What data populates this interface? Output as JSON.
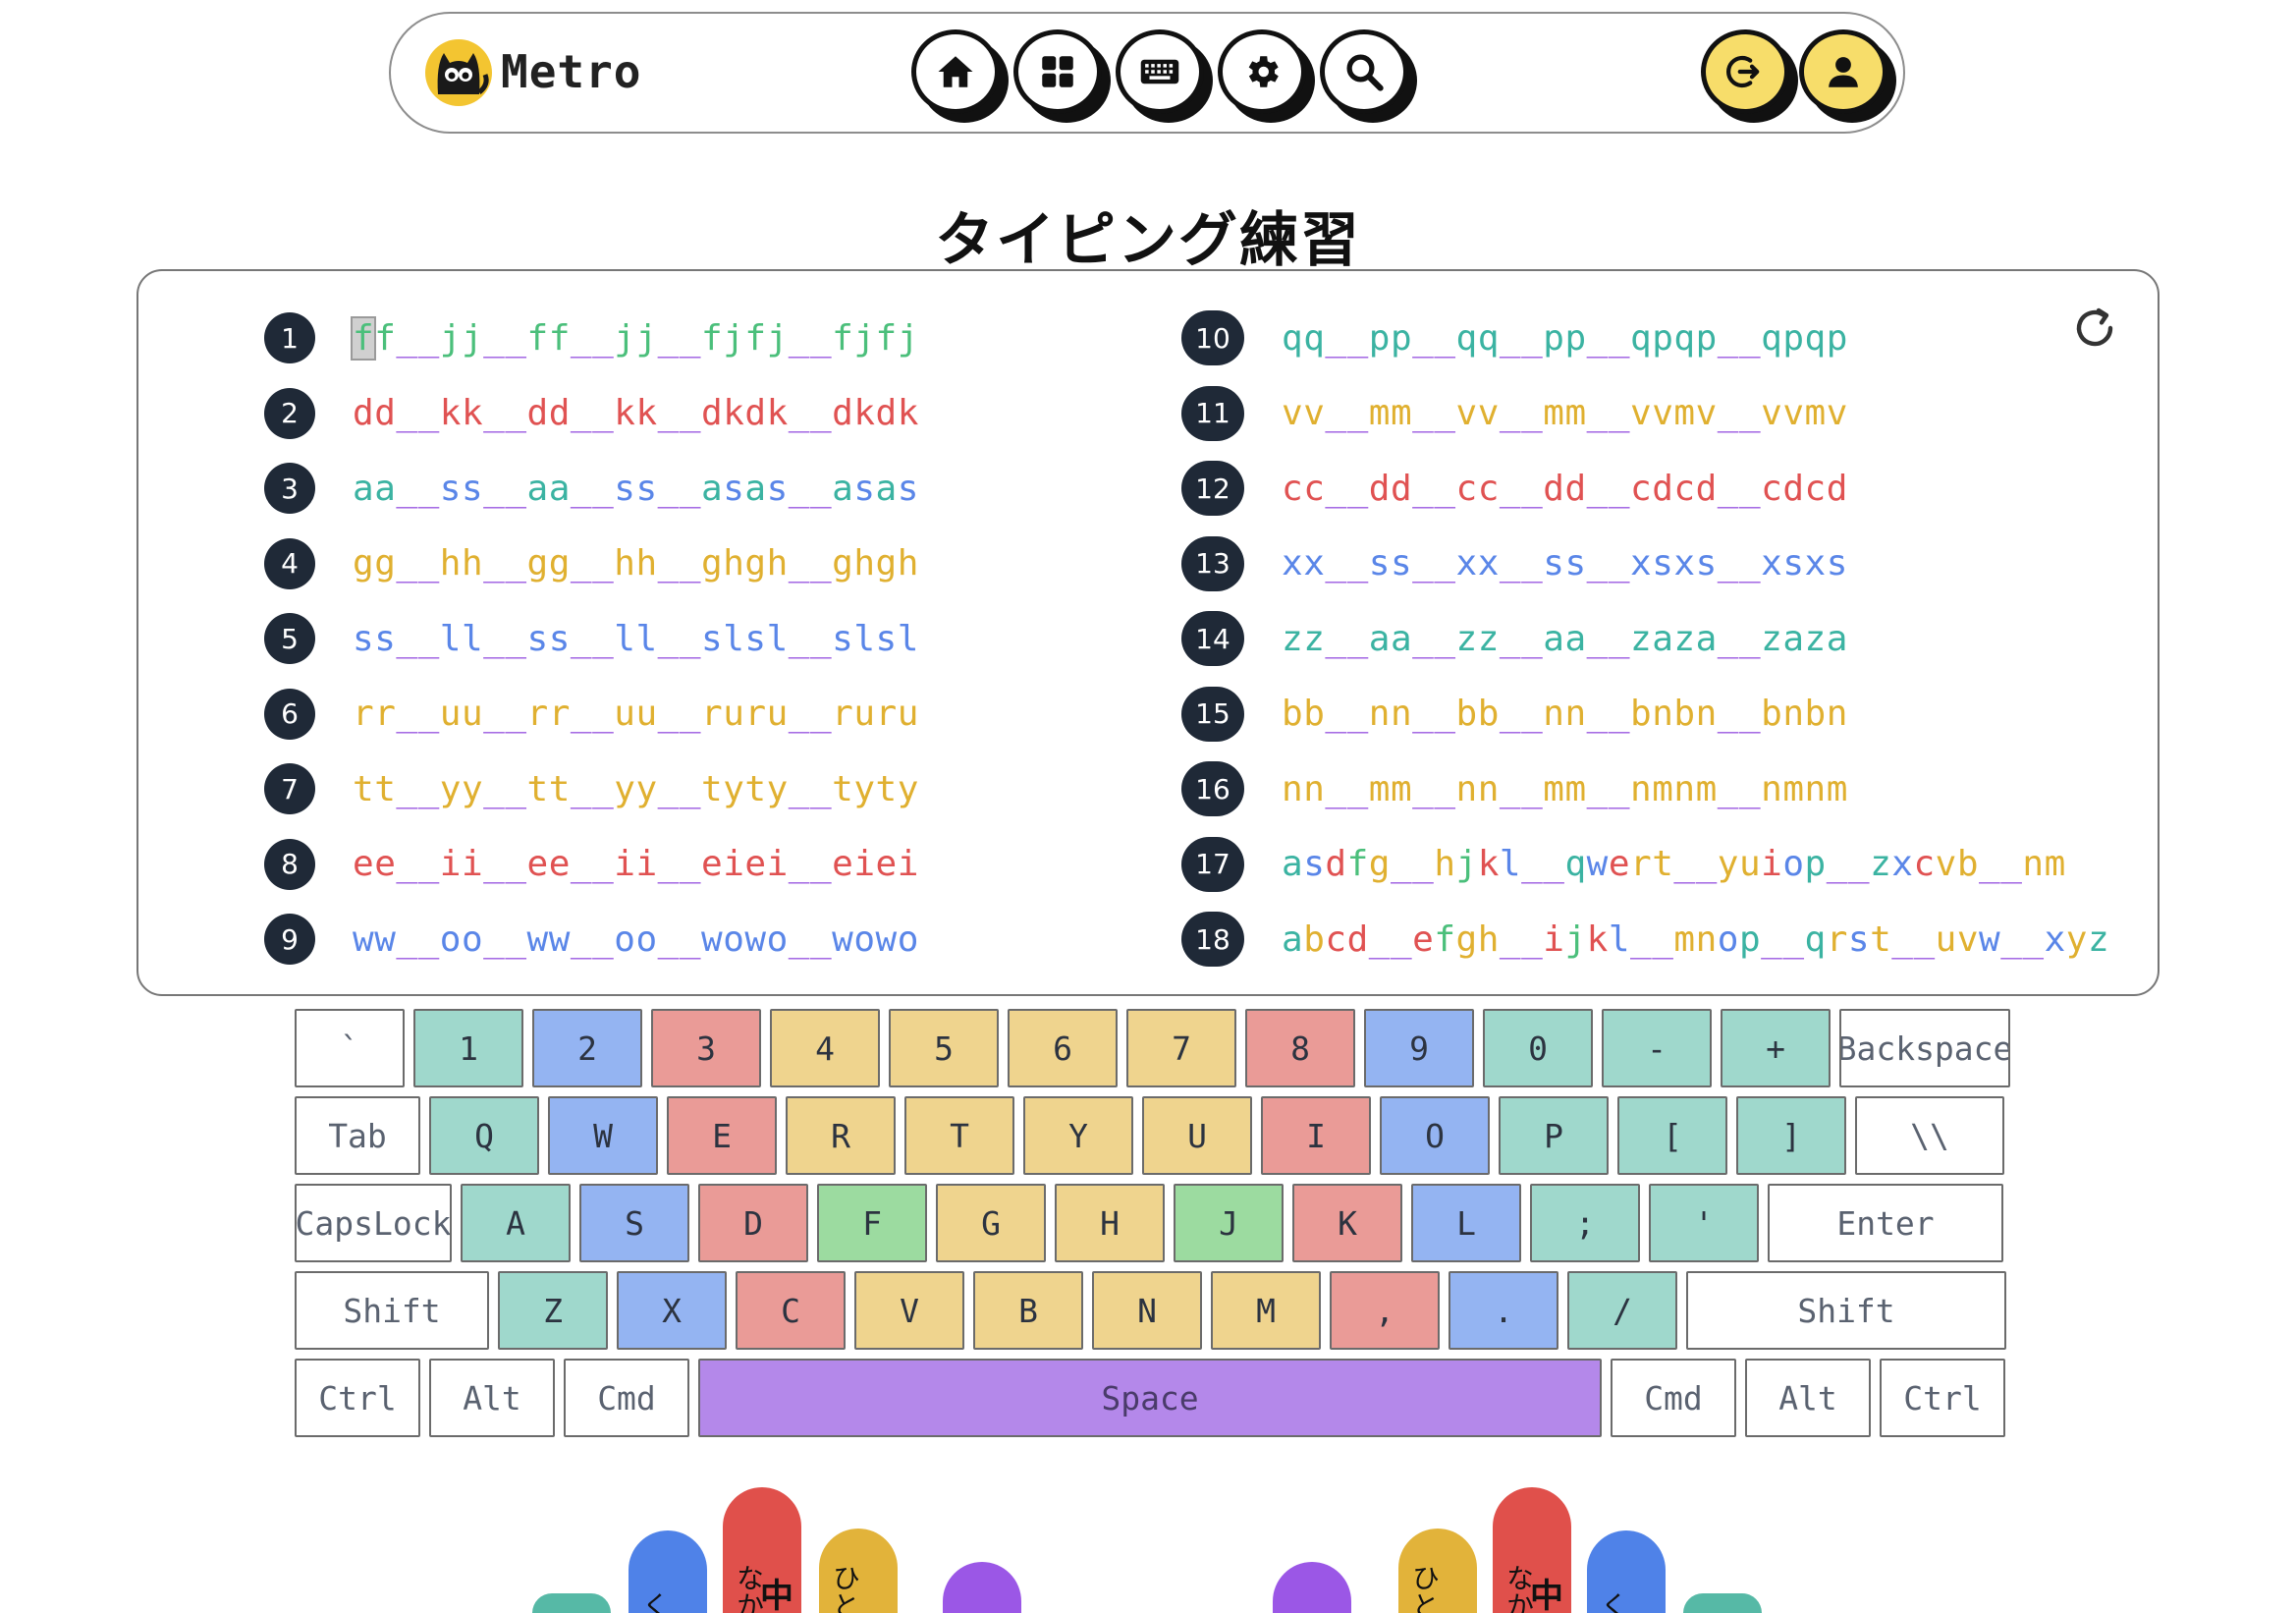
{
  "header": {
    "brand": "Metro",
    "nav": [
      "home-icon",
      "grid-icon",
      "keyboard-icon",
      "gear-icon",
      "search-icon"
    ],
    "actions": [
      "logout-icon",
      "user-icon"
    ]
  },
  "page_title": "タイピング練習",
  "exercises_left": [
    {
      "num": "1",
      "color": "#4bbf7b",
      "text": "ff__jj__ff__jj__fjfj__fjfj"
    },
    {
      "num": "2",
      "color": "#e05252",
      "text": "dd__kk__dd__kk__dkdk__dkdk"
    },
    {
      "num": "3",
      "color": "#3bb3a2",
      "alt": "#5a86e8",
      "text": "aa__ss__aa__ss__asas__asas"
    },
    {
      "num": "4",
      "color": "#e0b030",
      "text": "gg__hh__gg__hh__ghgh__ghgh"
    },
    {
      "num": "5",
      "color": "#5a86e8",
      "text": "ss__ll__ss__ll__slsl__slsl"
    },
    {
      "num": "6",
      "color": "#e0b030",
      "text": "rr__uu__rr__uu__ruru__ruru"
    },
    {
      "num": "7",
      "color": "#e0b030",
      "text": "tt__yy__tt__yy__tyty__tyty"
    },
    {
      "num": "8",
      "color": "#e05252",
      "text": "ee__ii__ee__ii__eiei__eiei"
    },
    {
      "num": "9",
      "color": "#5a86e8",
      "text": "ww__oo__ww__oo__wowo__wowo"
    }
  ],
  "exercises_right": [
    {
      "num": "10",
      "color": "#3bb3a2",
      "text": "qq__pp__qq__pp__qpqp__qpqp"
    },
    {
      "num": "11",
      "color": "#e0b030",
      "text": "vv__mm__vv__mm__vvmv__vvmv"
    },
    {
      "num": "12",
      "color": "#e05252",
      "text": "cc__dd__cc__dd__cdcd__cdcd"
    },
    {
      "num": "13",
      "color": "#5a86e8",
      "text": "xx__ss__xx__ss__xsxs__xsxs"
    },
    {
      "num": "14",
      "color": "#3bb3a2",
      "text": "zz__aa__zz__aa__zaza__zaza"
    },
    {
      "num": "15",
      "color": "#e0b030",
      "text": "bb__nn__bb__nn__bnbn__bnbn"
    },
    {
      "num": "16",
      "color": "#e0b030",
      "text": "nn__mm__nn__mm__nmnm__nmnm"
    },
    {
      "num": "17",
      "color": "#3bb3a2",
      "text": "asdfg__hjkl__qwert__yuiop__zxcvb__nm"
    },
    {
      "num": "18",
      "color": "#3bb3a2",
      "text": "abcd__efgh__ijkl__mnop__qrst__uvw__xyz"
    }
  ],
  "char_colors": {
    "a": "#3bb3a2",
    "q": "#3bb3a2",
    "z": "#3bb3a2",
    "p": "#3bb3a2",
    "s": "#5a86e8",
    "w": "#5a86e8",
    "x": "#5a86e8",
    "l": "#5a86e8",
    "o": "#5a86e8",
    "d": "#e05252",
    "e": "#e05252",
    "c": "#e05252",
    "k": "#e05252",
    "i": "#e05252",
    "f": "#4bbf7b",
    "j": "#4bbf7b",
    "g": "#e0b030",
    "h": "#e0b030",
    "r": "#e0b030",
    "t": "#e0b030",
    "y": "#e0b030",
    "u": "#e0b030",
    "v": "#e0b030",
    "b": "#e0b030",
    "n": "#e0b030",
    "m": "#e0b030",
    "_": "#9b59e0"
  },
  "keyboard": {
    "row1": [
      {
        "label": "`",
        "c": "white"
      },
      {
        "label": "1",
        "c": "teal"
      },
      {
        "label": "2",
        "c": "blue"
      },
      {
        "label": "3",
        "c": "red"
      },
      {
        "label": "4",
        "c": "yellow"
      },
      {
        "label": "5",
        "c": "yellow"
      },
      {
        "label": "6",
        "c": "yellow"
      },
      {
        "label": "7",
        "c": "yellow"
      },
      {
        "label": "8",
        "c": "red"
      },
      {
        "label": "9",
        "c": "blue"
      },
      {
        "label": "0",
        "c": "teal"
      },
      {
        "label": "-",
        "c": "teal"
      },
      {
        "label": "+",
        "c": "teal"
      },
      {
        "label": "Backspace",
        "c": "white"
      }
    ],
    "row2": [
      {
        "label": "Tab",
        "c": "white"
      },
      {
        "label": "Q",
        "c": "teal"
      },
      {
        "label": "W",
        "c": "blue"
      },
      {
        "label": "E",
        "c": "red"
      },
      {
        "label": "R",
        "c": "yellow"
      },
      {
        "label": "T",
        "c": "yellow"
      },
      {
        "label": "Y",
        "c": "yellow"
      },
      {
        "label": "U",
        "c": "yellow"
      },
      {
        "label": "I",
        "c": "red"
      },
      {
        "label": "O",
        "c": "blue"
      },
      {
        "label": "P",
        "c": "teal"
      },
      {
        "label": "[",
        "c": "teal"
      },
      {
        "label": "]",
        "c": "teal"
      },
      {
        "label": "\\\\",
        "c": "white"
      }
    ],
    "row3": [
      {
        "label": "CapsLock",
        "c": "white"
      },
      {
        "label": "A",
        "c": "teal"
      },
      {
        "label": "S",
        "c": "blue"
      },
      {
        "label": "D",
        "c": "red"
      },
      {
        "label": "F",
        "c": "green"
      },
      {
        "label": "G",
        "c": "yellow"
      },
      {
        "label": "H",
        "c": "yellow"
      },
      {
        "label": "J",
        "c": "green"
      },
      {
        "label": "K",
        "c": "red"
      },
      {
        "label": "L",
        "c": "blue"
      },
      {
        "label": ";",
        "c": "teal"
      },
      {
        "label": "'",
        "c": "teal"
      },
      {
        "label": "Enter",
        "c": "white"
      }
    ],
    "row4": [
      {
        "label": "Shift",
        "c": "white"
      },
      {
        "label": "Z",
        "c": "teal"
      },
      {
        "label": "X",
        "c": "blue"
      },
      {
        "label": "C",
        "c": "red"
      },
      {
        "label": "V",
        "c": "yellow"
      },
      {
        "label": "B",
        "c": "yellow"
      },
      {
        "label": "N",
        "c": "yellow"
      },
      {
        "label": "M",
        "c": "yellow"
      },
      {
        "label": ",",
        "c": "red"
      },
      {
        "label": ".",
        "c": "blue"
      },
      {
        "label": "/",
        "c": "teal"
      },
      {
        "label": "Shift",
        "c": "white"
      }
    ],
    "row5": [
      {
        "label": "Ctrl",
        "c": "white"
      },
      {
        "label": "Alt",
        "c": "white"
      },
      {
        "label": "Cmd",
        "c": "white"
      },
      {
        "label": "Space",
        "c": "purple"
      },
      {
        "label": "Cmd",
        "c": "white"
      },
      {
        "label": "Alt",
        "c": "white"
      },
      {
        "label": "Ctrl",
        "c": "white"
      }
    ]
  },
  "fingers": {
    "left": [
      {
        "name": "left-pinky",
        "color": "#56b9a6",
        "label": "",
        "main": ""
      },
      {
        "name": "left-ring",
        "color": "#4f82e8",
        "label": "く",
        "main": ""
      },
      {
        "name": "left-middle",
        "color": "#e0504b",
        "label": "なか",
        "main": "中"
      },
      {
        "name": "left-index",
        "color": "#e2b33a",
        "label": "ひと",
        "main": ""
      },
      {
        "name": "left-thumb",
        "color": "#9b57e6",
        "label": "",
        "main": ""
      }
    ],
    "right": [
      {
        "name": "right-thumb",
        "color": "#9b57e6",
        "label": "",
        "main": ""
      },
      {
        "name": "right-index",
        "color": "#e2b33a",
        "label": "ひと",
        "main": ""
      },
      {
        "name": "right-middle",
        "color": "#e0504b",
        "label": "なか",
        "main": "中"
      },
      {
        "name": "right-ring",
        "color": "#4f82e8",
        "label": "く",
        "main": ""
      },
      {
        "name": "right-pinky",
        "color": "#56b9a6",
        "label": "",
        "main": ""
      }
    ]
  }
}
